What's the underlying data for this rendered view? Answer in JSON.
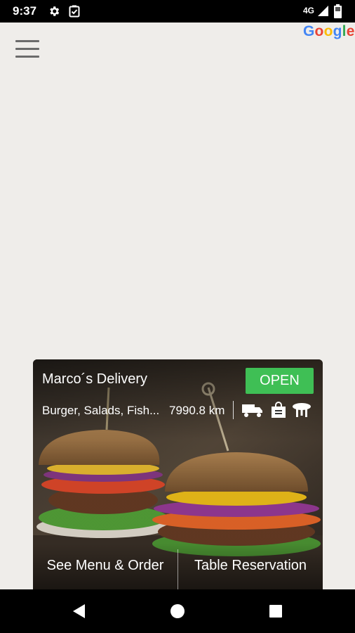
{
  "status_bar": {
    "time": "9:37",
    "network": "4G",
    "icons": [
      "settings-icon",
      "clipboard-check-icon",
      "signal-icon",
      "battery-icon"
    ]
  },
  "header": {
    "menu_icon": "hamburger-menu-icon",
    "map_attribution": [
      "G",
      "o",
      "o",
      "g",
      "l",
      "e"
    ]
  },
  "restaurant_card": {
    "name": "Marco´s Delivery",
    "status_label": "OPEN",
    "status_color": "#3fbf55",
    "cuisine": "Burger, Salads, Fish...",
    "distance": "7990.8 km",
    "service_icons": [
      "delivery-truck-icon",
      "shopping-bag-icon",
      "table-icon"
    ],
    "actions": {
      "menu_label": "See Menu & Order",
      "reservation_label": "Table Reservation"
    }
  },
  "nav_bar": {
    "buttons": [
      "back-icon",
      "home-icon",
      "recents-icon"
    ]
  }
}
